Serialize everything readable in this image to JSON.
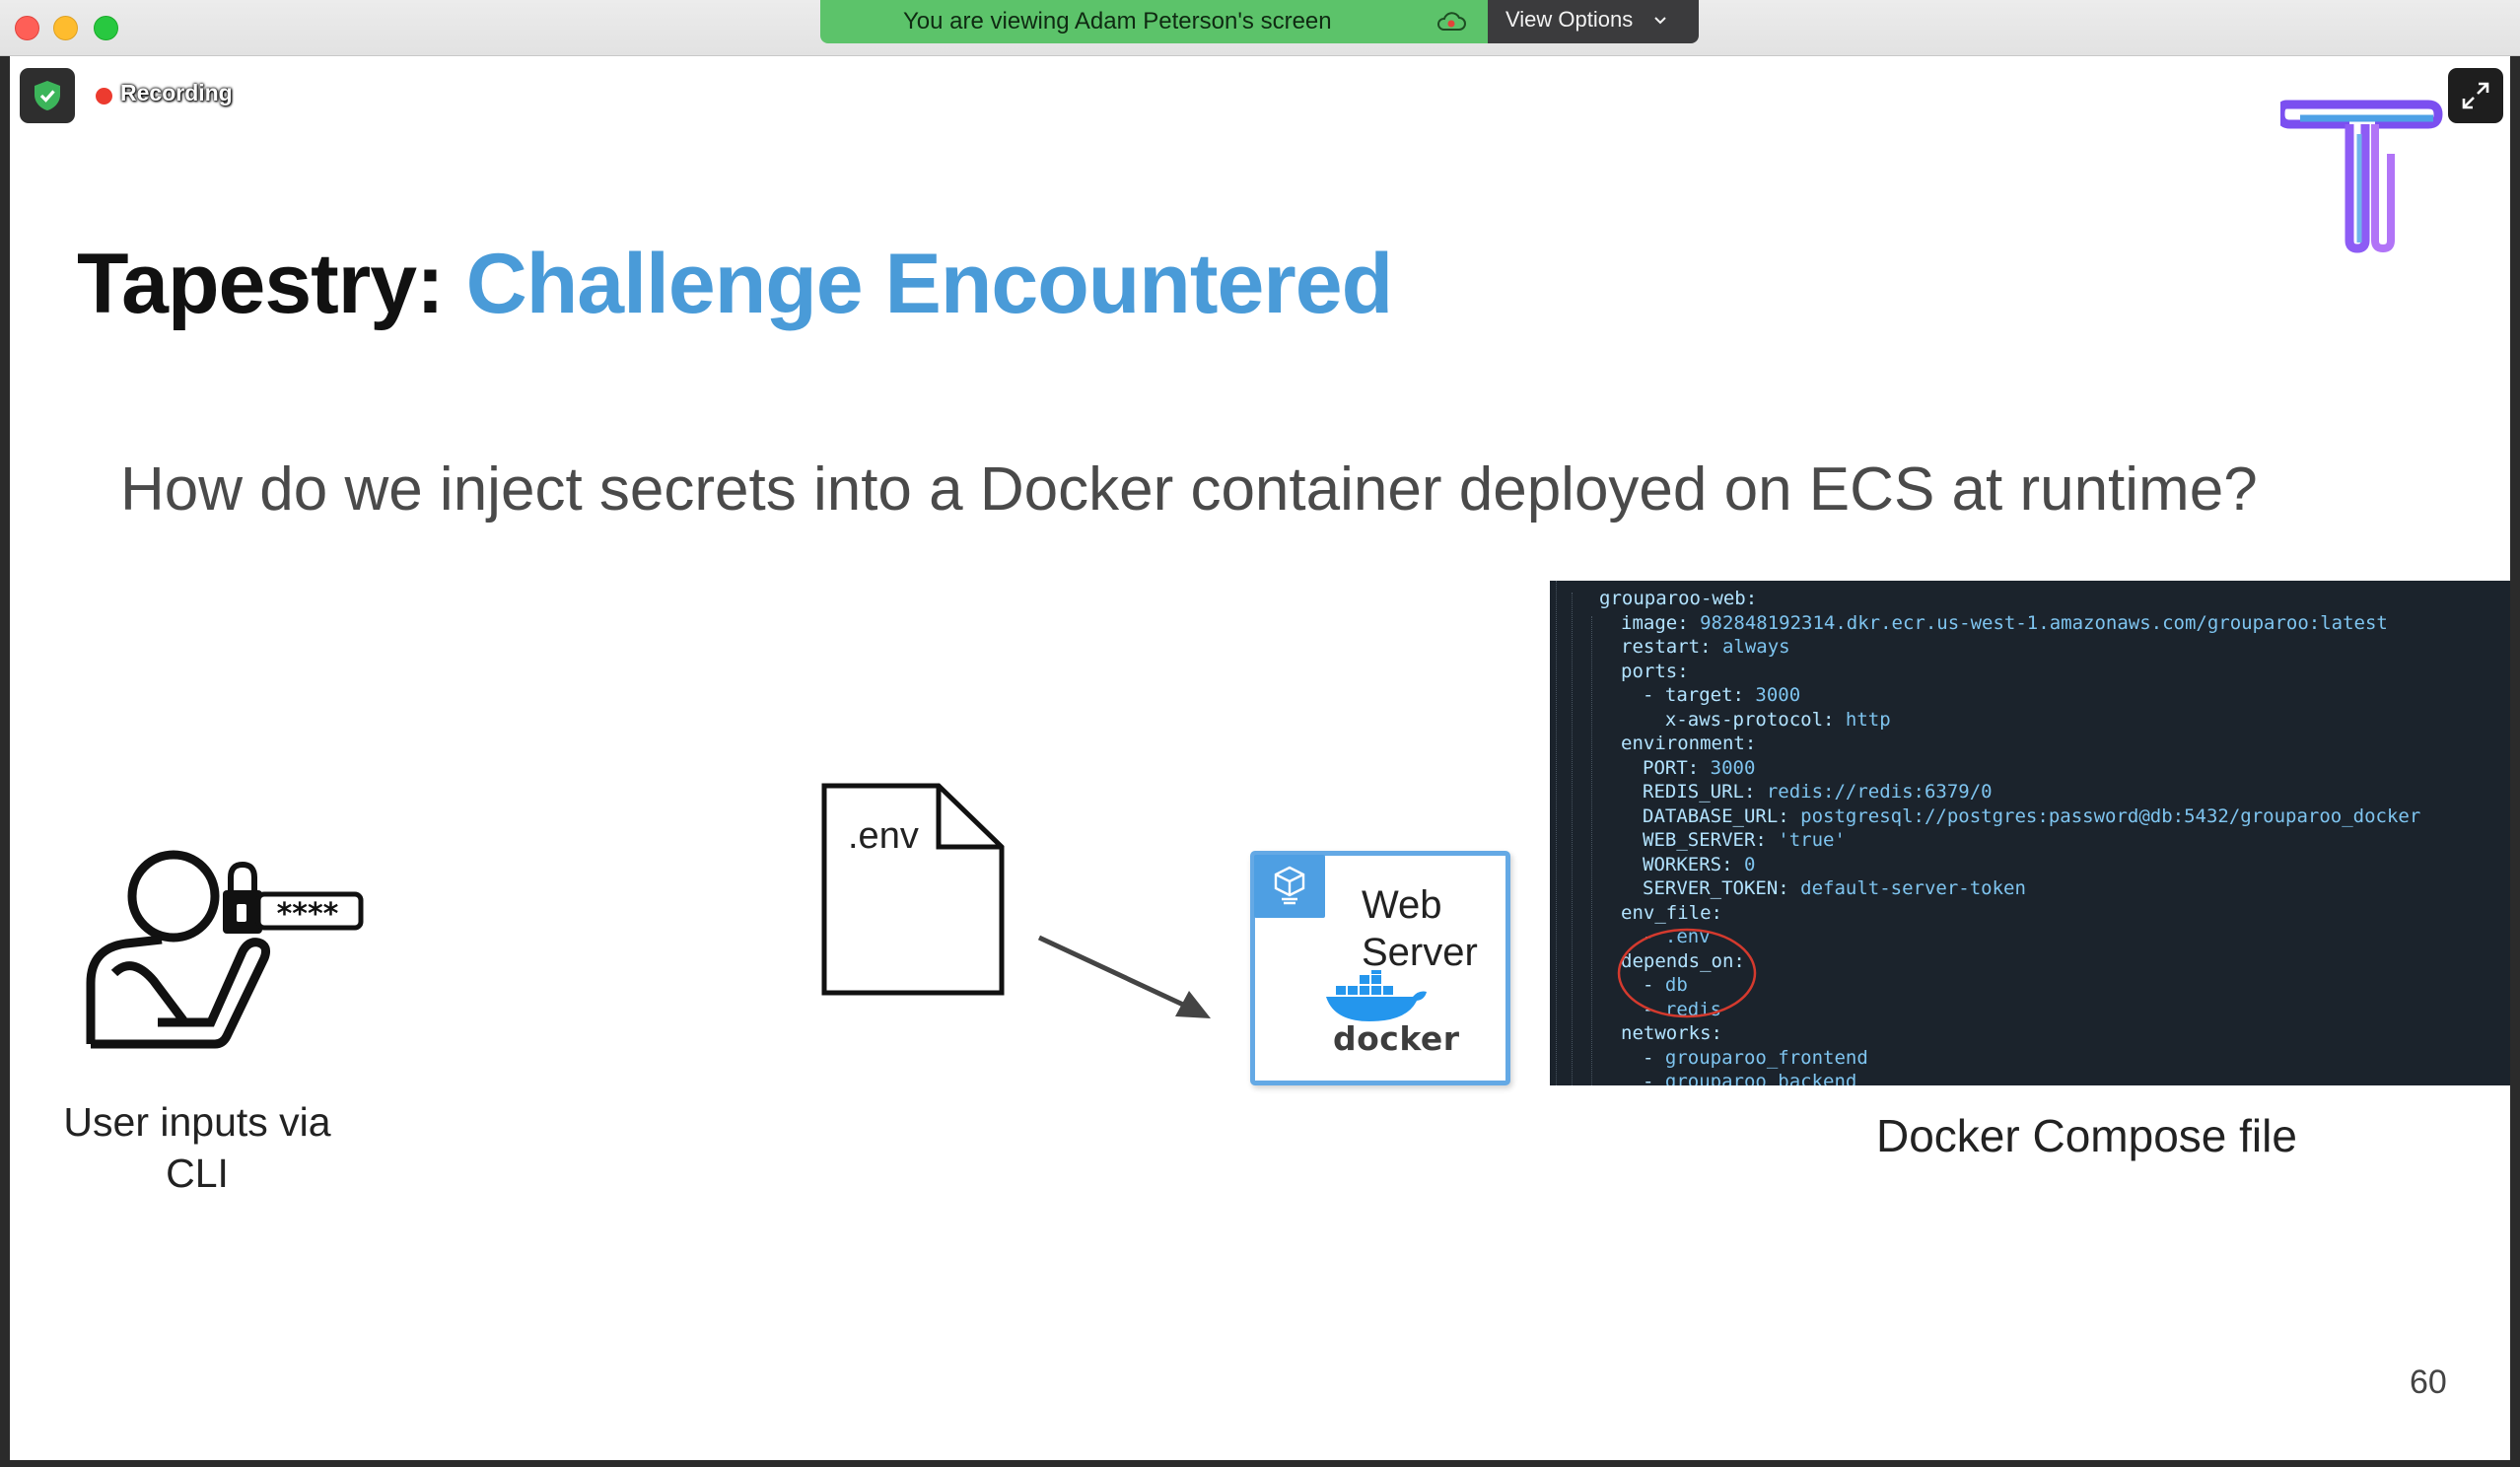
{
  "window": {
    "banner_text": "You are viewing Adam Peterson's screen",
    "view_options_label": "View Options",
    "banner_color": "#5cc36a"
  },
  "meeting": {
    "recording_label": "Recording",
    "recording_color": "#ec3b2f"
  },
  "slide": {
    "title_main": "Tapestry: ",
    "title_accent": "Challenge Encountered",
    "accent_color": "#4a9bd8",
    "subtitle": "How do we inject secrets into a Docker container deployed on ECS at runtime?",
    "password_mask": "****",
    "user_caption_line1": "User inputs via",
    "user_caption_line2": "CLI",
    "env_label": ".env",
    "webserver_line1": "Web",
    "webserver_line2": "Server",
    "docker_label": "docker",
    "compose_caption": "Docker Compose file",
    "page_number": "60",
    "code_lines": [
      {
        "indent": 0,
        "key": "grouparoo-web:",
        "val": ""
      },
      {
        "indent": 1,
        "key": "image:",
        "val": " 982848192314.dkr.ecr.us-west-1.amazonaws.com/grouparoo:latest"
      },
      {
        "indent": 1,
        "key": "restart:",
        "val": " always"
      },
      {
        "indent": 1,
        "key": "ports:",
        "val": ""
      },
      {
        "indent": 2,
        "key": "- target:",
        "val": " 3000"
      },
      {
        "indent": 2,
        "key": "  x-aws-protocol:",
        "val": " http"
      },
      {
        "indent": 1,
        "key": "environment:",
        "val": ""
      },
      {
        "indent": 2,
        "key": "PORT:",
        "val": " 3000"
      },
      {
        "indent": 2,
        "key": "REDIS_URL:",
        "val": " redis://redis:6379/0"
      },
      {
        "indent": 2,
        "key": "DATABASE_URL:",
        "val": " postgresql://postgres:password@db:5432/grouparoo_docker"
      },
      {
        "indent": 2,
        "key": "WEB_SERVER:",
        "val": " 'true'"
      },
      {
        "indent": 2,
        "key": "WORKERS:",
        "val": " 0"
      },
      {
        "indent": 2,
        "key": "SERVER_TOKEN:",
        "val": " default-server-token"
      },
      {
        "indent": 1,
        "key": "env_file:",
        "val": ""
      },
      {
        "indent": 2,
        "key": "- ",
        "val": ".env"
      },
      {
        "indent": 1,
        "key": "depends_on:",
        "val": ""
      },
      {
        "indent": 2,
        "key": "- ",
        "val": "db"
      },
      {
        "indent": 2,
        "key": "- ",
        "val": "redis"
      },
      {
        "indent": 1,
        "key": "networks:",
        "val": ""
      },
      {
        "indent": 2,
        "key": "- ",
        "val": "grouparoo_frontend"
      },
      {
        "indent": 2,
        "key": "- ",
        "val": "grouparoo_backend"
      }
    ]
  }
}
